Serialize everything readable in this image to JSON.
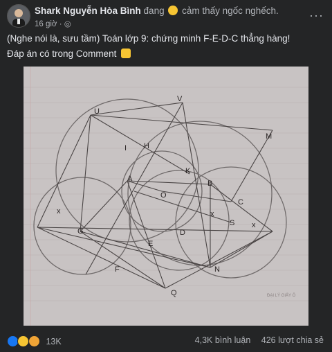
{
  "post": {
    "author": "Shark Nguyễn Hòa Bình",
    "feeling_prefix": "đang",
    "feeling": "cảm thấy ngốc nghếch.",
    "timestamp": "16 giờ",
    "line1": "(Nghe nói là, sưu tầm) Toán lớp 9: chứng minh F-E-D-C thẳng hàng!",
    "line2": "Đáp án có trong Comment"
  },
  "figure": {
    "labels": [
      "U",
      "V",
      "M",
      "I",
      "H",
      "K",
      "A",
      "O",
      "B",
      "C",
      "S",
      "D",
      "G",
      "E",
      "F",
      "N",
      "Q",
      "x",
      "x",
      "x"
    ],
    "watermark": "ĐẠI LÝ GIẤY Ô"
  },
  "footer": {
    "reactions_count": "13K",
    "comments": "4,3K bình luận",
    "shares": "426 lượt chia sẻ"
  },
  "colors": {
    "background": "#242526",
    "text": "#e4e6eb",
    "muted": "#b0b3b8",
    "like": "#1877f2"
  }
}
